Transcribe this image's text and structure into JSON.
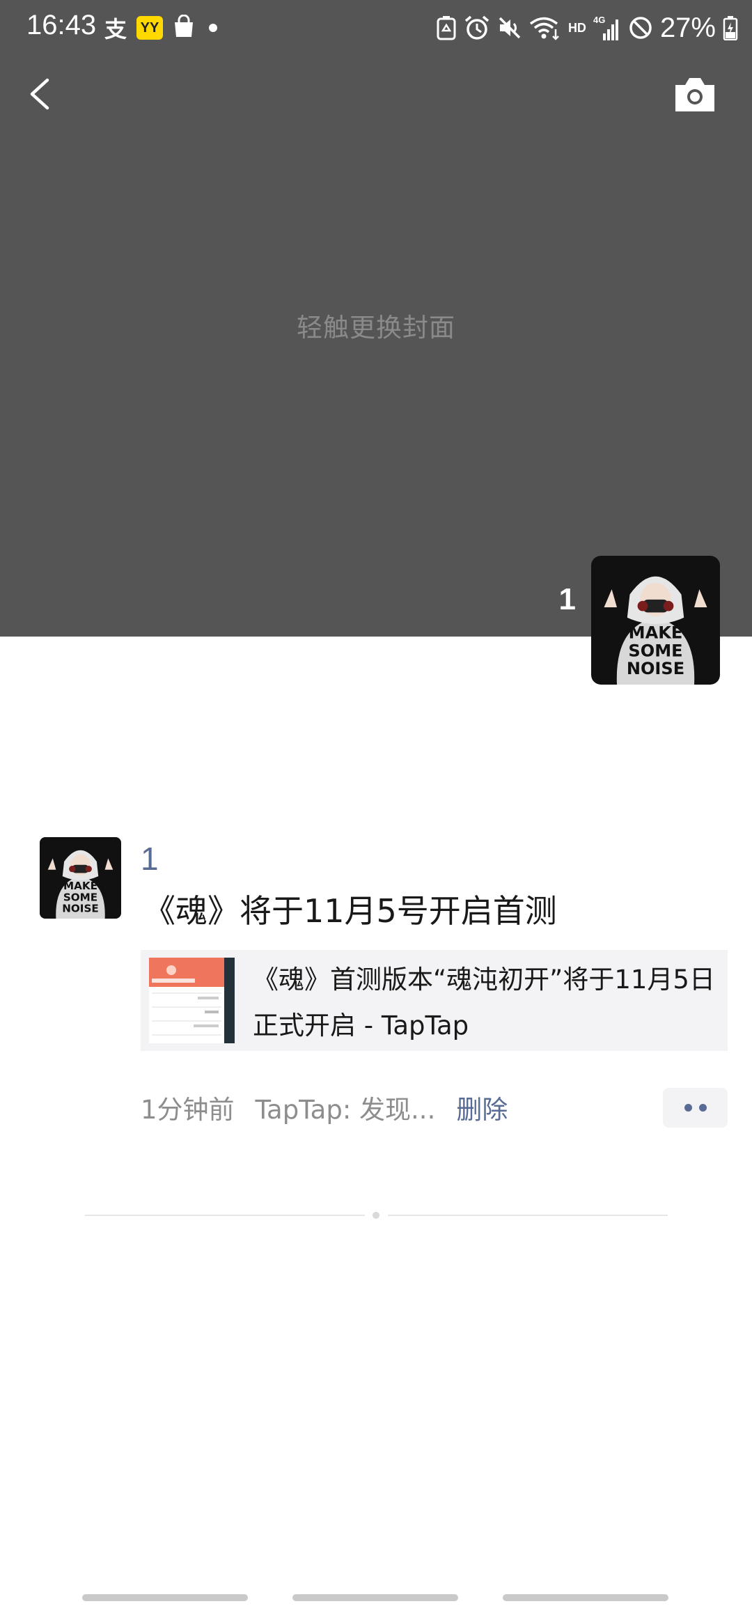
{
  "status_bar": {
    "time": "16:43",
    "alipay_icon_text": "支",
    "yy_icon_text": "YY",
    "network_label": "HD",
    "battery_percent": "27%"
  },
  "cover": {
    "hint": "轻触更换封面",
    "background_color": "#555555"
  },
  "nav": {
    "back_icon": "chevron-left-icon",
    "camera_icon": "camera-icon"
  },
  "owner": {
    "name": "1",
    "avatar_caption": [
      "MAKE",
      "SOME",
      "NOISE"
    ]
  },
  "post": {
    "author": "1",
    "text": "《魂》将于11月5号开启首测",
    "link_title": "《魂》首测版本“魂沌初开”将于11月5日正式开启 - TapTap",
    "time": "1分钟前",
    "source": "TapTap: 发现...",
    "delete_label": "删除"
  },
  "colors": {
    "link_blue": "#576b95",
    "meta_gray": "#8d8d8d",
    "card_bg": "#f3f3f5"
  }
}
